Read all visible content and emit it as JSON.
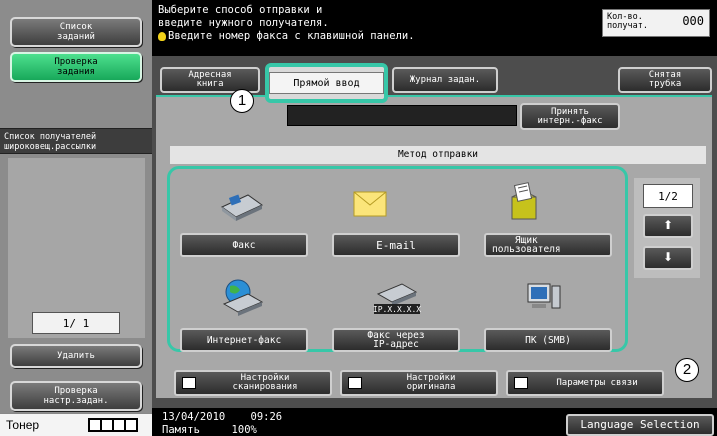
{
  "sidebar": {
    "job_list_label": "Список\nзаданий",
    "check_job_label": "Проверка\nзадания",
    "broadcast_header": "Список получателей\nшироковещ.рассылки",
    "page_counter": "1/ 1",
    "delete_label": "Удалить",
    "check_settings_label": "Проверка\nнастр.задан.",
    "toner_label": "Тонер"
  },
  "header": {
    "message_line1": "Выберите способ отправки и",
    "message_line2": "введите нужного получателя.",
    "message_line3": "Введите номер факса с клавишной панели.",
    "count_label": "Кол-во.\nполучат.",
    "count_value": "000"
  },
  "tabs": {
    "address_book": "Адресная\nкнига",
    "direct_input": "Прямой ввод",
    "job_log": "Журнал задан.",
    "off_hook": "Снятая\nтрубка"
  },
  "accept_fax_label": "Принять\nинтерн.-факс",
  "method_header": "Метод отправки",
  "methods": [
    {
      "label": "Факс",
      "icon": "fax-icon"
    },
    {
      "label": "E-mail",
      "icon": "envelope-icon"
    },
    {
      "label": "Ящик\nпользователя",
      "icon": "user-box-icon"
    },
    {
      "label": "Интернет-факс",
      "icon": "internet-fax-icon"
    },
    {
      "label": "Факс через\nIP-адрес",
      "icon": "ip-fax-icon"
    },
    {
      "label": "ПК (SMB)",
      "icon": "pc-icon"
    }
  ],
  "pager": {
    "label": "1/2"
  },
  "bottom": {
    "scan_settings": "Настройки\nсканирования",
    "original_settings": "Настройки\nоригинала",
    "comm_settings": "Параметры связи"
  },
  "status": {
    "date": "13/04/2010",
    "time": "09:26",
    "memory_label": "Память",
    "memory_value": "100%",
    "language_button": "Language Selection"
  },
  "callouts": [
    "1",
    "2"
  ],
  "colors": {
    "accent": "#37c7a8",
    "active_green": "#22b866"
  }
}
